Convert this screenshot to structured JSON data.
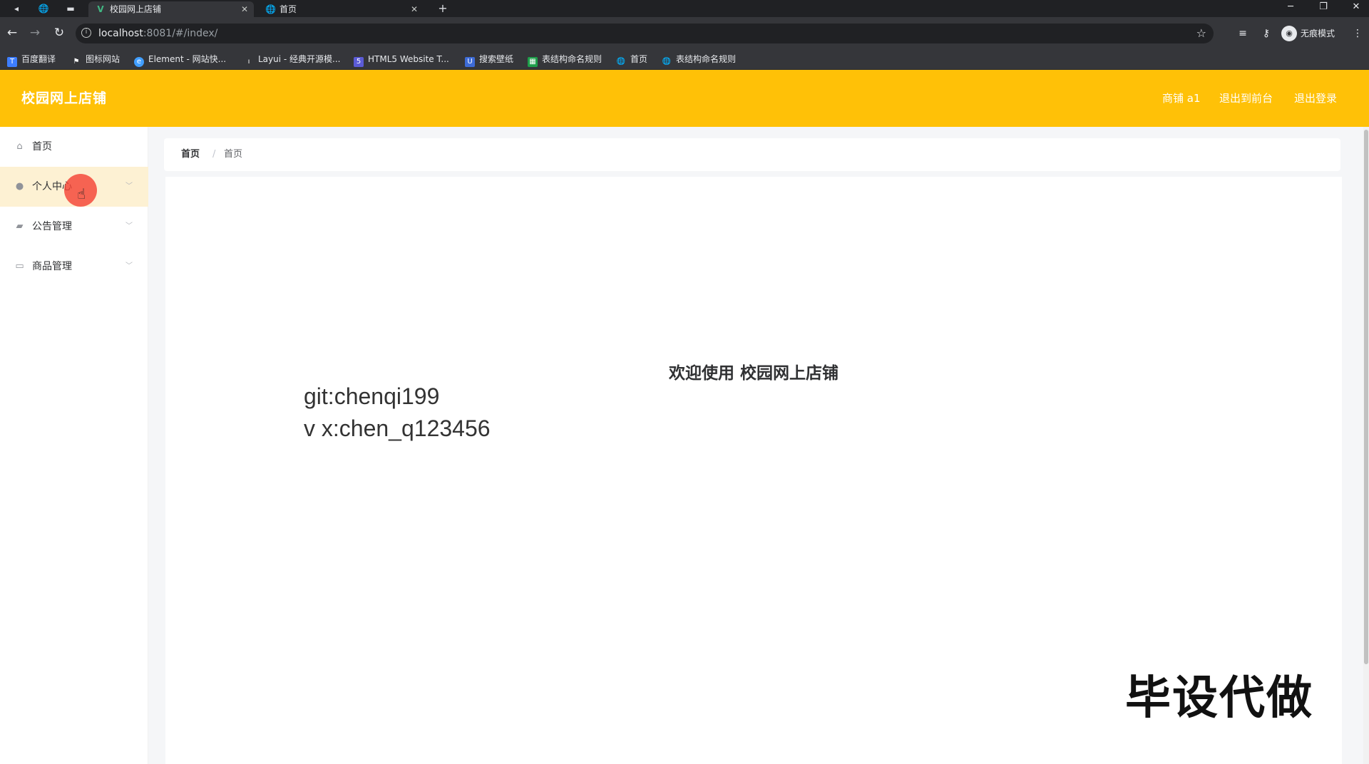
{
  "browser": {
    "tabs": [
      {
        "title": "校园网上店铺",
        "favicon": "vue-logo-icon",
        "active": true
      },
      {
        "title": "首页",
        "favicon": "globe-icon",
        "active": false
      }
    ],
    "url_host": "localhost",
    "url_path": ":8081/#/index/",
    "incognito_label": "无痕模式",
    "bookmarks": [
      {
        "label": "百度翻译",
        "icon": "baidu-translate-icon",
        "color": "#3d7eff"
      },
      {
        "label": "图标网站",
        "icon": "flag-icon",
        "color": "#35363a"
      },
      {
        "label": "Element - 网站快...",
        "icon": "element-icon",
        "color": "#409eff"
      },
      {
        "label": "Layui - 经典开源模...",
        "icon": "layui-icon",
        "color": "#35363a"
      },
      {
        "label": "HTML5 Website T...",
        "icon": "html5-icon",
        "color": "#5b5bd6"
      },
      {
        "label": "搜索壁纸",
        "icon": "wallpaper-icon",
        "color": "#3d6bd6"
      },
      {
        "label": "表结构命名规则",
        "icon": "sheet-icon",
        "color": "#1e9e4a"
      },
      {
        "label": "首页",
        "icon": "globe-icon",
        "color": "#35363a"
      },
      {
        "label": "表结构命名规则",
        "icon": "globe-icon",
        "color": "#35363a"
      }
    ]
  },
  "header": {
    "brand": "校园网上店铺",
    "links": [
      "商铺 a1",
      "退出到前台",
      "退出登录"
    ],
    "accent_color": "#ffc107"
  },
  "sidebar": {
    "items": [
      {
        "label": "首页",
        "icon": "home-icon",
        "has_arrow": false
      },
      {
        "label": "个人中心",
        "icon": "user-icon",
        "has_arrow": true,
        "active": true
      },
      {
        "label": "公告管理",
        "icon": "ticket-icon",
        "has_arrow": true
      },
      {
        "label": "商品管理",
        "icon": "card-icon",
        "has_arrow": true
      }
    ]
  },
  "breadcrumb": {
    "items": [
      "首页",
      "首页"
    ],
    "separator": "/"
  },
  "main": {
    "welcome": "欢迎使用 校园网上店铺"
  },
  "overlay": {
    "line1": "git:chenqi199",
    "line2": "v x:chen_q123456",
    "watermark": "毕设代做"
  }
}
